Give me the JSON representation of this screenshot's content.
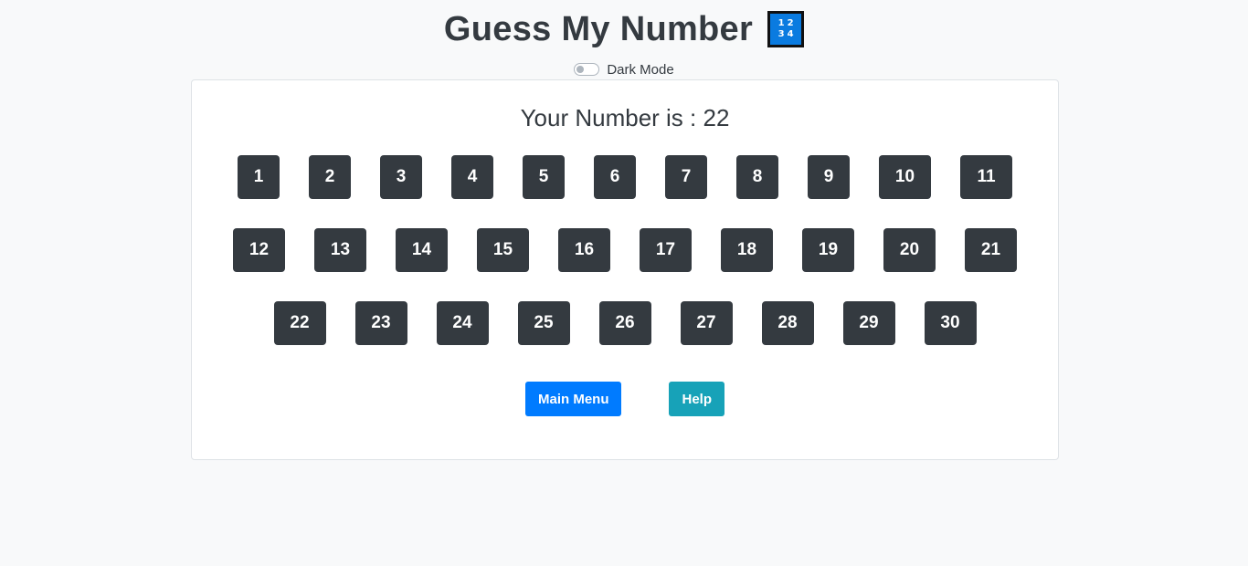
{
  "header": {
    "title": "Guess My Number",
    "logo_digits": [
      "1",
      "2",
      "3",
      "4"
    ]
  },
  "dark_mode": {
    "label": "Dark Mode",
    "enabled": false
  },
  "game": {
    "your_number_text": "Your Number is : 22",
    "rows": [
      [
        "1",
        "2",
        "3",
        "4",
        "5",
        "6",
        "7",
        "8",
        "9",
        "10",
        "11"
      ],
      [
        "12",
        "13",
        "14",
        "15",
        "16",
        "17",
        "18",
        "19",
        "20",
        "21"
      ],
      [
        "22",
        "23",
        "24",
        "25",
        "26",
        "27",
        "28",
        "29",
        "30"
      ]
    ]
  },
  "actions": {
    "main_menu_label": "Main Menu",
    "help_label": "Help"
  },
  "colors": {
    "background": "#f8f9fa",
    "number_button": "#343a40",
    "main_menu_button": "#007bff",
    "help_button": "#17a2b8",
    "logo_blue": "#0a7be0"
  }
}
